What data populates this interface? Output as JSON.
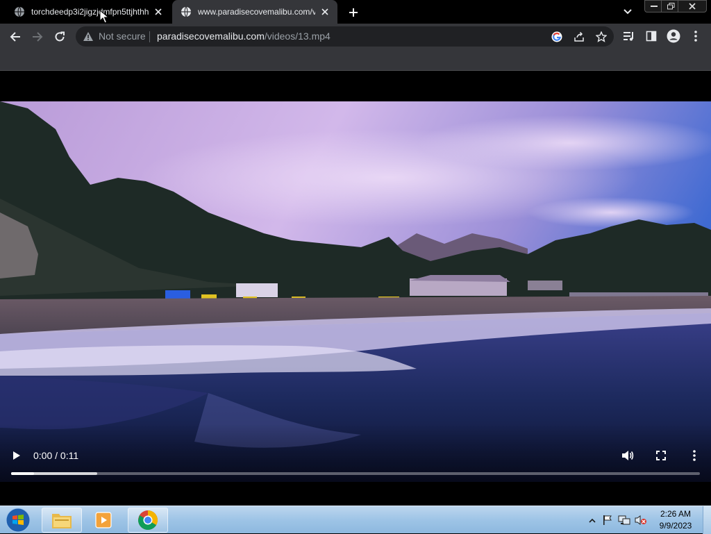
{
  "browser": {
    "tabs": [
      {
        "title": "torchdeedp3i2jigzjdmfpn5ttjhthh",
        "active": false
      },
      {
        "title": "www.paradisecovemalibu.com/vi",
        "active": true
      }
    ],
    "omnibox": {
      "security_label": "Not secure",
      "url_host": "paradisecovemalibu.com",
      "url_path": "/videos/13.mp4"
    }
  },
  "video": {
    "time_label": "0:00 / 0:11",
    "progress_played": 0.033,
    "progress_buffered": 0.125
  },
  "taskbar": {
    "apps": [
      "file-explorer",
      "media-player",
      "chrome"
    ],
    "clock_time": "2:26 AM",
    "clock_date": "9/9/2023"
  },
  "colors": {
    "tab_active_bg": "#35363a",
    "omnibox_bg": "#202124",
    "chrome_text": "#e8eaed",
    "taskbar_blue": "#9ec4e6"
  }
}
